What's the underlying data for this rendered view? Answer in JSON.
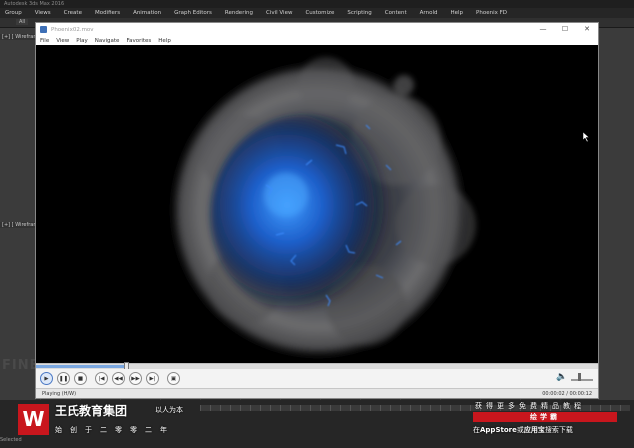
{
  "max": {
    "title": "Autodesk 3ds Max 2016",
    "menu": [
      "Group",
      "Views",
      "Create",
      "Modifiers",
      "Animation",
      "Graph Editors",
      "Rendering",
      "Civil View",
      "Customize",
      "Scripting",
      "Content",
      "Arnold",
      "Help",
      "Phoenix FD"
    ],
    "toolbar_label": "All",
    "viewport_label_top": "[+] [ Wireframe ]",
    "viewport_label_mid": "[+] [ Wireframe ]",
    "bottom_watermark": "FINE",
    "status": "Selected"
  },
  "player": {
    "title": "Phoenix02.mov",
    "menu": [
      "File",
      "View",
      "Play",
      "Navigate",
      "Favorites",
      "Help"
    ],
    "status_left": "Playing (H/W)",
    "status_right": "00:00:02 / 00:00:12",
    "progress": 0.16,
    "volume": 0.3,
    "controls": [
      {
        "name": "play-button",
        "icon": "▶"
      },
      {
        "name": "pause-button",
        "icon": "❚❚"
      },
      {
        "name": "stop-button",
        "icon": "■"
      },
      {
        "name": "previous-button",
        "icon": "|◀"
      },
      {
        "name": "rewind-button",
        "icon": "◀◀"
      },
      {
        "name": "forward-button",
        "icon": "▶▶"
      },
      {
        "name": "next-button",
        "icon": "▶|"
      },
      {
        "name": "fullscreen-button",
        "icon": "▣"
      }
    ]
  },
  "watermark": {
    "brand_name": "王氏教育集团",
    "slogan": "以人为本",
    "since": "始创于二零零二年",
    "promo_line1": "获得更多免费精品教程",
    "promo_line2": "绘学霸",
    "promo_line3_a": "在",
    "promo_line3_b": "AppStore",
    "promo_line3_c": "或",
    "promo_line3_d": "应用宝",
    "promo_line3_e": "搜索下载",
    "logo_letter": "W"
  },
  "colors": {
    "accent": "#c8161d",
    "sphere_core": "#1e6fd6",
    "smoke": "#8a8a8a"
  }
}
